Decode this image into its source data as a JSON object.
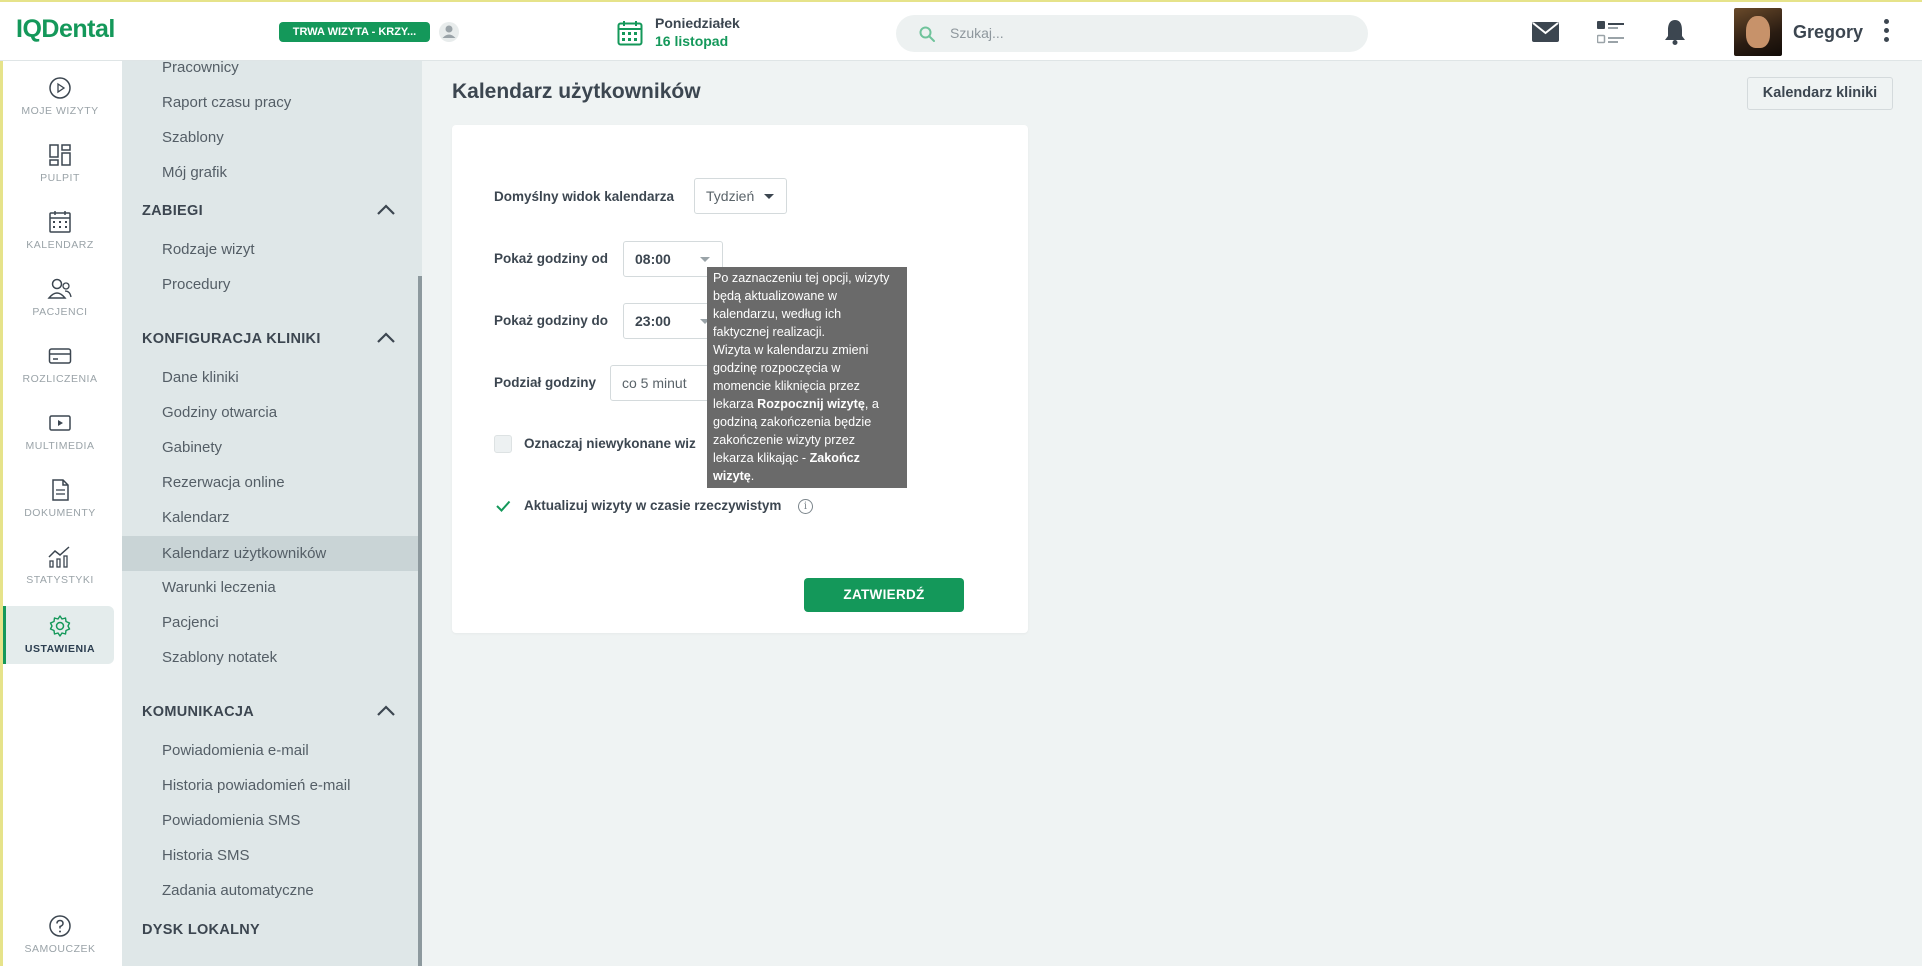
{
  "app": {
    "logo": "IQDental"
  },
  "header": {
    "visit_status": "TRWA WIZYTA - KRZY...",
    "day_name": "Poniedziałek",
    "date": "16 listopad",
    "search_placeholder": "Szukaj...",
    "username": "Gregory"
  },
  "rail": [
    {
      "label": "MOJE WIZYTY",
      "icon": "play-circle-icon"
    },
    {
      "label": "PULPIT",
      "icon": "dashboard-icon"
    },
    {
      "label": "KALENDARZ",
      "icon": "calendar-icon"
    },
    {
      "label": "PACJENCI",
      "icon": "patients-icon"
    },
    {
      "label": "ROZLICZENIA",
      "icon": "credit-card-icon"
    },
    {
      "label": "MULTIMEDIA",
      "icon": "multimedia-icon"
    },
    {
      "label": "DOKUMENTY",
      "icon": "document-icon"
    },
    {
      "label": "STATYSTYKI",
      "icon": "statistics-icon"
    },
    {
      "label": "USTAWIENIA",
      "icon": "settings-gear-icon",
      "active": true
    },
    {
      "label": "SAMOUCZEK",
      "icon": "help-icon"
    }
  ],
  "settings_menu": {
    "top_items": [
      "Pracownicy",
      "Raport czasu pracy",
      "Szablony",
      "Mój grafik"
    ],
    "sections": [
      {
        "title": "ZABIEGI",
        "items": [
          "Rodzaje wizyt",
          "Procedury"
        ]
      },
      {
        "title": "KONFIGURACJA KLINIKI",
        "items": [
          "Dane kliniki",
          "Godziny otwarcia",
          "Gabinety",
          "Rezerwacja online",
          "Kalendarz",
          "Kalendarz użytkowników",
          "Warunki leczenia",
          "Pacjenci",
          "Szablony notatek"
        ]
      },
      {
        "title": "KOMUNIKACJA",
        "items": [
          "Powiadomienia e-mail",
          "Historia powiadomień e-mail",
          "Powiadomienia SMS",
          "Historia SMS",
          "Zadania automatyczne"
        ]
      },
      {
        "title": "DYSK LOKALNY",
        "items": []
      }
    ],
    "active_item": "Kalendarz użytkowników"
  },
  "main": {
    "title": "Kalendarz użytkowników",
    "clinic_calendar_button": "Kalendarz kliniki",
    "form": {
      "default_view_label": "Domyślny widok kalendarza",
      "default_view_value": "Tydzień",
      "hours_from_label": "Pokaż godziny od",
      "hours_from_value": "08:00",
      "hours_to_label": "Pokaż godziny do",
      "hours_to_value": "23:00",
      "division_label": "Podział godziny",
      "division_value": "co 5 minut",
      "mark_unfinished_label": "Oznaczaj niewykonane wiz",
      "mark_unfinished_checked": false,
      "realtime_label": "Aktualizuj wizyty w czasie rzeczywistym",
      "realtime_checked": true,
      "submit": "ZATWIERDŹ"
    },
    "tooltip": {
      "line1": "Po zaznaczeniu tej opcji, wizyty",
      "line2": "będą aktualizowane w",
      "line3": "kalendarzu, według ich",
      "line4": "faktycznej realizacji.",
      "line5": "Wizyta w kalendarzu zmieni",
      "line6": "godzinę rozpoczęcia w",
      "line7": "momencie kliknięcia przez",
      "line8a": "lekarza ",
      "line8b": "Rozpocznij wizytę",
      "line8c": ", a",
      "line9": "godziną zakończenia będzie",
      "line10": "zakończenie wizyty przez",
      "line11a": "lekarza klikając - ",
      "line11b": "Zakończ",
      "line12a": "wizytę",
      "line12b": "."
    }
  },
  "colors": {
    "brand": "#14985a",
    "text": "#3c4650",
    "panel": "#dfe7e8"
  }
}
